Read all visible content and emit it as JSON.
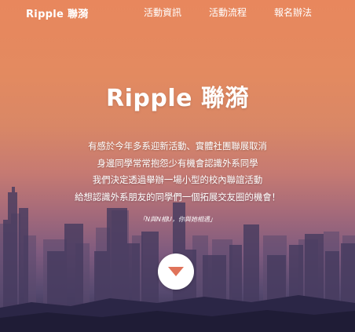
{
  "nav": {
    "brand": "Ripple 聯漪",
    "links": [
      "活動資訊",
      "活動流程",
      "報名辦法"
    ]
  },
  "hero": {
    "title": "Ripple 聯漪",
    "description": [
      "有感於今年多系迎新活動、實體社團聯展取消",
      "身邊同學常常抱怨少有機會認識外系同學",
      "我們決定透過舉辦一場小型的校內聯誼活動",
      "給想認識外系朋友的同學們一個拓展交友圈的機會！"
    ],
    "tagline": "「N與N相U，你與她相遇」",
    "scroll_icon": "chevron-down-icon"
  },
  "colors": {
    "text": "#ffffff",
    "arrow": "#e0735a",
    "button_bg": "#ffffff"
  }
}
